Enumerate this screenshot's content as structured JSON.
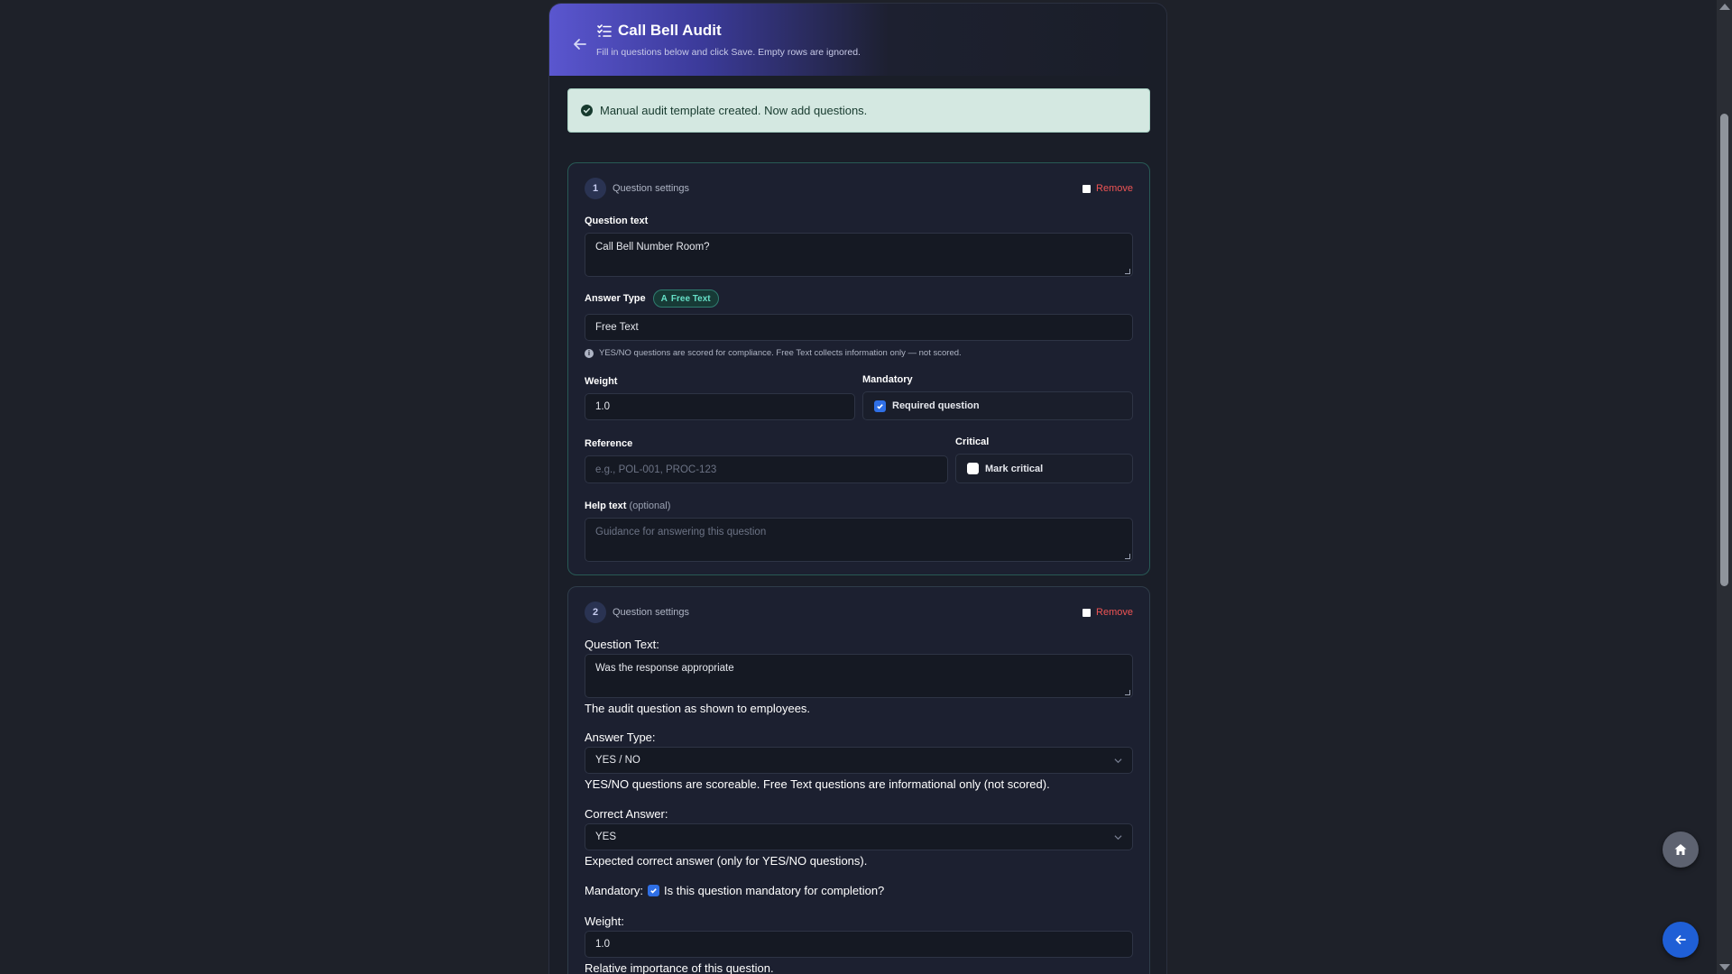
{
  "header": {
    "title": "Call Bell Audit",
    "subtitle": "Fill in questions below and click Save. Empty rows are ignored."
  },
  "alert": {
    "text": "Manual audit template created. Now add questions."
  },
  "question1": {
    "number": "1",
    "section_label": "Question settings",
    "remove_label": "Remove",
    "question_text_label": "Question text",
    "question_text_value": "Call Bell Number Room?",
    "answer_type_label": "Answer Type",
    "answer_type_badge": "Free Text",
    "answer_type_value": "Free Text",
    "answer_type_hint": "YES/NO questions are scored for compliance. Free Text collects information only — not scored.",
    "weight_label": "Weight",
    "weight_value": "1.0",
    "mandatory_label": "Mandatory",
    "mandatory_checkbox_label": "Required question",
    "mandatory_checked": true,
    "reference_label": "Reference",
    "reference_placeholder": "e.g., POL-001, PROC-123",
    "critical_label": "Critical",
    "critical_checkbox_label": "Mark critical",
    "critical_checked": false,
    "help_text_label": "Help text",
    "help_text_optional": "(optional)",
    "help_text_placeholder": "Guidance for answering this question"
  },
  "question2": {
    "number": "2",
    "section_label": "Question settings",
    "remove_label": "Remove",
    "question_text_label": "Question Text:",
    "question_text_value": "Was the response appropriate",
    "question_text_help": "The audit question as shown to employees.",
    "answer_type_label": "Answer Type:",
    "answer_type_value": "YES / NO",
    "answer_type_help": "YES/NO questions are scoreable. Free Text questions are informational only (not scored).",
    "correct_answer_label": "Correct Answer:",
    "correct_answer_value": "YES",
    "correct_answer_help": "Expected correct answer (only for YES/NO questions).",
    "mandatory_label": "Mandatory:",
    "mandatory_checkbox_label": "Is this question mandatory for completion?",
    "mandatory_checked": true,
    "weight_label": "Weight:",
    "weight_value": "1.0",
    "weight_help": "Relative importance of this question."
  },
  "colors": {
    "accent": "#5a56cf",
    "success": "#d4e8e1",
    "danger": "#ef5454",
    "checkbox": "#2f6fe6",
    "fab_back": "#1f5fd6"
  }
}
